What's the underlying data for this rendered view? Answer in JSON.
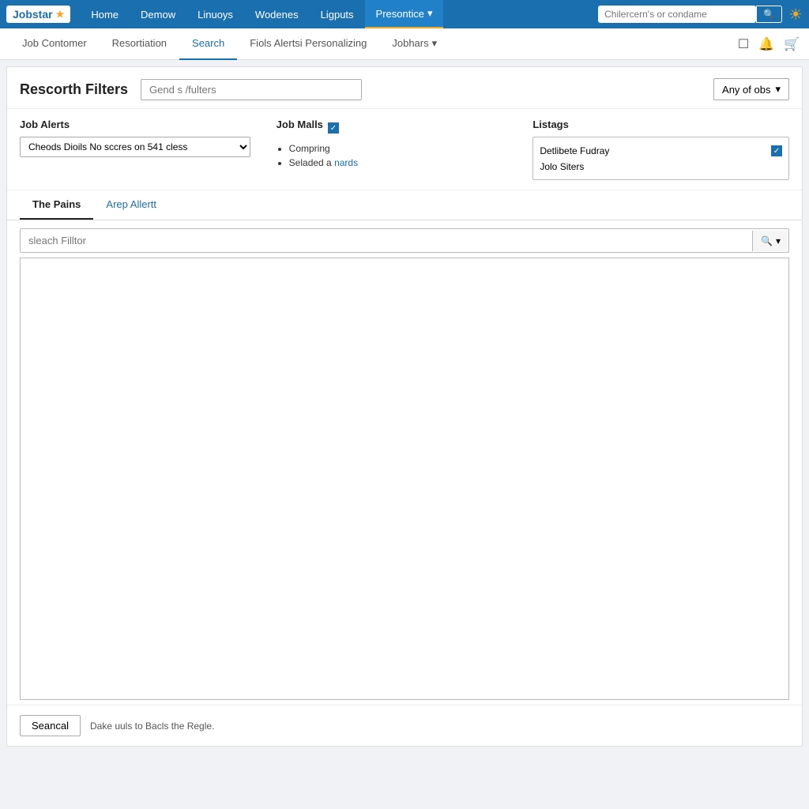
{
  "topNav": {
    "logo": "Jobstar",
    "logoStar": "★",
    "links": [
      {
        "label": "Home",
        "active": false
      },
      {
        "label": "Demow",
        "active": false
      },
      {
        "label": "Linuoys",
        "active": false
      },
      {
        "label": "Wodenes",
        "active": false
      },
      {
        "label": "Ligputs",
        "active": false
      },
      {
        "label": "Presontice",
        "active": true,
        "dropdown": true
      }
    ],
    "searchPlaceholder": "Chilercern's or condame",
    "searchBtn": "🔍"
  },
  "subNav": {
    "links": [
      {
        "label": "Job Contomer",
        "active": false
      },
      {
        "label": "Resortiation",
        "active": false
      },
      {
        "label": "Search",
        "active": true
      },
      {
        "label": "Fiols Alertsi Personalizing",
        "active": false
      },
      {
        "label": "Jobhars",
        "active": false,
        "dropdown": true
      }
    ],
    "icons": [
      "☐",
      "🔔",
      "🛒"
    ]
  },
  "filters": {
    "title": "Rescorth Filters",
    "inputPlaceholder": "Gend s /fulters",
    "dropdownLabel": "Any of obs",
    "jobAlerts": {
      "title": "Job Alerts",
      "selectValue": "Cheods Dioils No sccres on 541 cless"
    },
    "jobMalls": {
      "title": "Job Malls",
      "checked": true,
      "items": [
        {
          "label": "Compring"
        },
        {
          "label": "Seladed a",
          "link": "nards"
        }
      ]
    },
    "listags": {
      "title": "Listags",
      "rows": [
        {
          "label": "Detlibete Fudray",
          "checked": true
        },
        {
          "label": "Jolo Siters",
          "checked": false
        }
      ]
    }
  },
  "tabs": {
    "items": [
      {
        "label": "The Pains",
        "active": true
      },
      {
        "label": "Arep Allertt",
        "active": false,
        "blue": true
      }
    ]
  },
  "searchFilter": {
    "placeholder": "sleach Filltor",
    "btnLabel": "🔍 ▾"
  },
  "footer": {
    "cancelLabel": "Seancal",
    "footerText": "Dake uuls to Bacls the Regle."
  }
}
